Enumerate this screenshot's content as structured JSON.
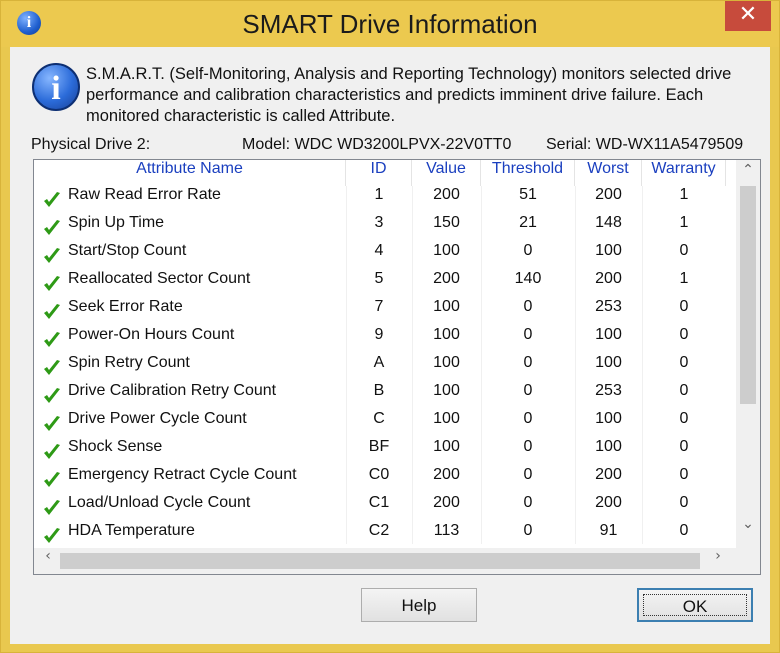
{
  "window": {
    "title": "SMART Drive Information",
    "close_glyph": "✕",
    "title_icon": "info-icon"
  },
  "description": "S.M.A.R.T. (Self-Monitoring, Analysis and Reporting Technology) monitors selected drive performance and calibration characteristics and predicts imminent drive failure. Each monitored characteristic is called Attribute.",
  "drive": {
    "physical_label": "Physical Drive 2:",
    "model_label": "Model: WDC WD3200LPVX-22V0TT0",
    "serial_label": "Serial: WD-WX11A5479509"
  },
  "table": {
    "columns": [
      "Attribute Name",
      "ID",
      "Value",
      "Threshold",
      "Worst",
      "Warranty"
    ],
    "rows": [
      [
        "Raw Read Error Rate",
        "1",
        "200",
        "51",
        "200",
        "1"
      ],
      [
        "Spin Up Time",
        "3",
        "150",
        "21",
        "148",
        "1"
      ],
      [
        "Start/Stop Count",
        "4",
        "100",
        "0",
        "100",
        "0"
      ],
      [
        "Reallocated Sector Count",
        "5",
        "200",
        "140",
        "200",
        "1"
      ],
      [
        "Seek Error Rate",
        "7",
        "100",
        "0",
        "253",
        "0"
      ],
      [
        "Power-On Hours Count",
        "9",
        "100",
        "0",
        "100",
        "0"
      ],
      [
        "Spin Retry Count",
        "A",
        "100",
        "0",
        "100",
        "0"
      ],
      [
        "Drive Calibration Retry Count",
        "B",
        "100",
        "0",
        "253",
        "0"
      ],
      [
        "Drive Power Cycle Count",
        "C",
        "100",
        "0",
        "100",
        "0"
      ],
      [
        "Shock Sense",
        "BF",
        "100",
        "0",
        "100",
        "0"
      ],
      [
        "Emergency Retract Cycle Count",
        "C0",
        "200",
        "0",
        "200",
        "0"
      ],
      [
        "Load/Unload Cycle Count",
        "C1",
        "200",
        "0",
        "200",
        "0"
      ],
      [
        "HDA Temperature",
        "C2",
        "113",
        "0",
        "91",
        "0"
      ]
    ],
    "status_icon": "check-icon",
    "status_color": "#2e9a16"
  },
  "scroll": {
    "up": "⌃",
    "down": "⌄",
    "left": "‹",
    "right": "›"
  },
  "buttons": {
    "help": "Help",
    "ok": "OK"
  },
  "colors": {
    "titlebar": "#ecc94f",
    "close": "#c74b3c",
    "header_text": "#1a3fbf"
  }
}
